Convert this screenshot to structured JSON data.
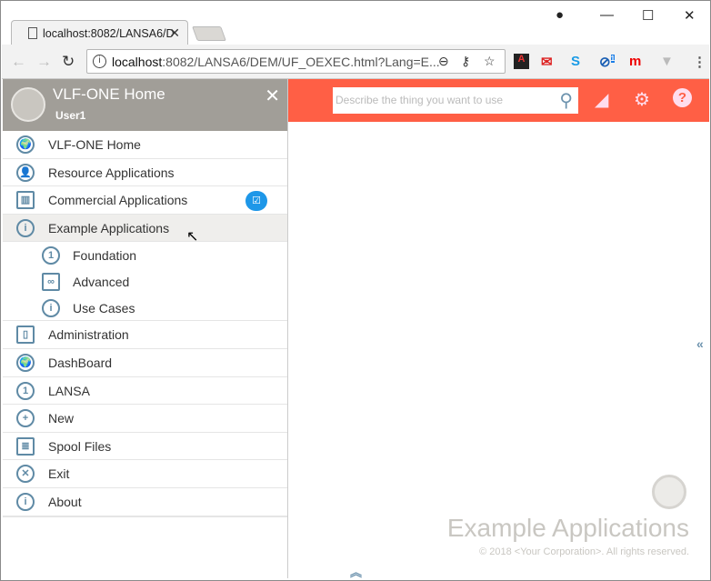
{
  "browser": {
    "tab_title": "localhost:8082/LANSA6/D",
    "url_host": "localhost",
    "url_rest": ":8082/LANSA6/DEM/UF_OEXEC.html?Lang=E...",
    "extension_badge": "1"
  },
  "sidebar": {
    "title": "VLF-ONE Home",
    "user": "User1",
    "items": [
      {
        "label": "VLF-ONE Home",
        "icon": "globe-icon",
        "glyph": "🌍"
      },
      {
        "label": "Resource Applications",
        "icon": "user-icon",
        "glyph": "👤"
      },
      {
        "label": "Commercial Applications",
        "icon": "factory-icon",
        "glyph": "▥",
        "badge": "☑"
      },
      {
        "label": "Example Applications",
        "icon": "info-icon",
        "glyph": "i"
      },
      {
        "label": "Foundation",
        "icon": "number-one-icon",
        "glyph": "1",
        "sub": true
      },
      {
        "label": "Advanced",
        "icon": "link-icon",
        "glyph": "∞",
        "sub": true
      },
      {
        "label": "Use Cases",
        "icon": "info-icon",
        "glyph": "i",
        "sub": true
      },
      {
        "label": "Administration",
        "icon": "clipboard-icon",
        "glyph": "▯"
      },
      {
        "label": "DashBoard",
        "icon": "globe-icon",
        "glyph": "🌍"
      },
      {
        "label": "LANSA",
        "icon": "number-one-icon",
        "glyph": "1"
      },
      {
        "label": "New",
        "icon": "plus-icon",
        "glyph": "+"
      },
      {
        "label": "Spool Files",
        "icon": "document-icon",
        "glyph": "≣"
      },
      {
        "label": "Exit",
        "icon": "close-circle-icon",
        "glyph": "✕"
      },
      {
        "label": "About",
        "icon": "info-icon",
        "glyph": "i"
      }
    ]
  },
  "topbar": {
    "search_placeholder": "Describe the thing you want to use",
    "accent": "#ff5f45"
  },
  "content": {
    "title": "Example Applications",
    "copyright": "© 2018 <Your Corporation>. All rights reserved."
  }
}
